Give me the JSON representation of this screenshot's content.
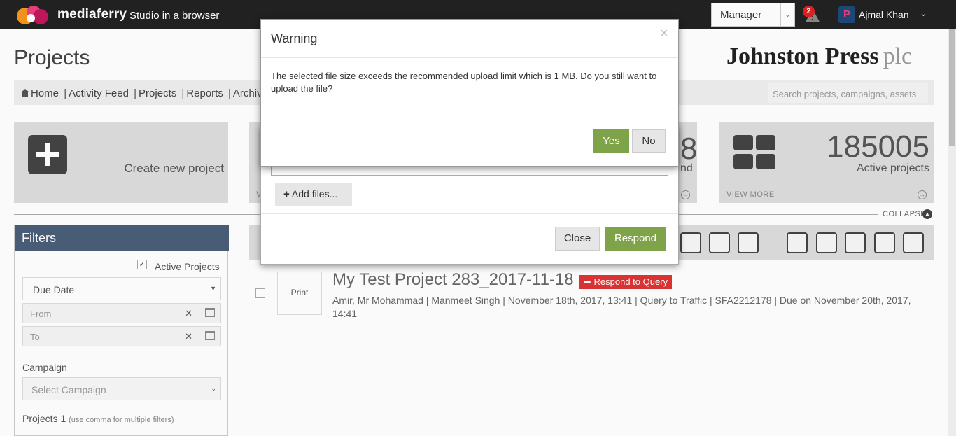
{
  "header": {
    "logo_text": "mediaferry",
    "logo_sub": "Studio in a browser",
    "role_value": "Manager",
    "alert_count": "2",
    "avatar_letter": "P",
    "user_name": "Ajmal Khan"
  },
  "page": {
    "title": "Projects",
    "brand_name": "Johnston Press",
    "brand_suffix": "plc"
  },
  "nav": {
    "items": [
      "Home",
      "Activity Feed",
      "Projects",
      "Reports",
      "Archive"
    ],
    "search_placeholder": "Search projects, campaigns, assets"
  },
  "cards": {
    "new_project_label": "Create new project",
    "mid_digit": "8",
    "mid_label": "nd",
    "active_count": "185005",
    "active_label": "Active projects",
    "view_more": "VIEW MORE",
    "mid_view_more": "V"
  },
  "collapse_label": "COLLAPSE",
  "filters": {
    "heading": "Filters",
    "active_projects_label": "Active Projects",
    "active_projects_checked": true,
    "sort_value": "Due Date",
    "from_placeholder": "From",
    "to_placeholder": "To",
    "campaign_label": "Campaign",
    "campaign_placeholder": "Select Campaign",
    "projects_label": "Projects 1",
    "projects_hint": "(use comma for multiple filters)"
  },
  "project_row": {
    "print_label": "Print",
    "title": "My Test Project 283_2017-11-18",
    "status_label": "Respond to Query",
    "meta": "Amir, Mr Mohammad | Manmeet Singh | November 18th, 2017, 13:41 | Query to Traffic | SFA2212178 | Due on November 20th, 2017, 14:41"
  },
  "respond_dialog": {
    "add_files_label": "Add files...",
    "close_label": "Close",
    "respond_label": "Respond"
  },
  "warning_dialog": {
    "title": "Warning",
    "message": "The selected file size exceeds the recommended upload limit which is 1 MB. Do you still want to upload the file?",
    "yes_label": "Yes",
    "no_label": "No"
  },
  "colors": {
    "topbar": "#222222",
    "filters_header": "#4a5f78",
    "primary_green": "#7fa349",
    "danger_red": "#dd3333"
  }
}
